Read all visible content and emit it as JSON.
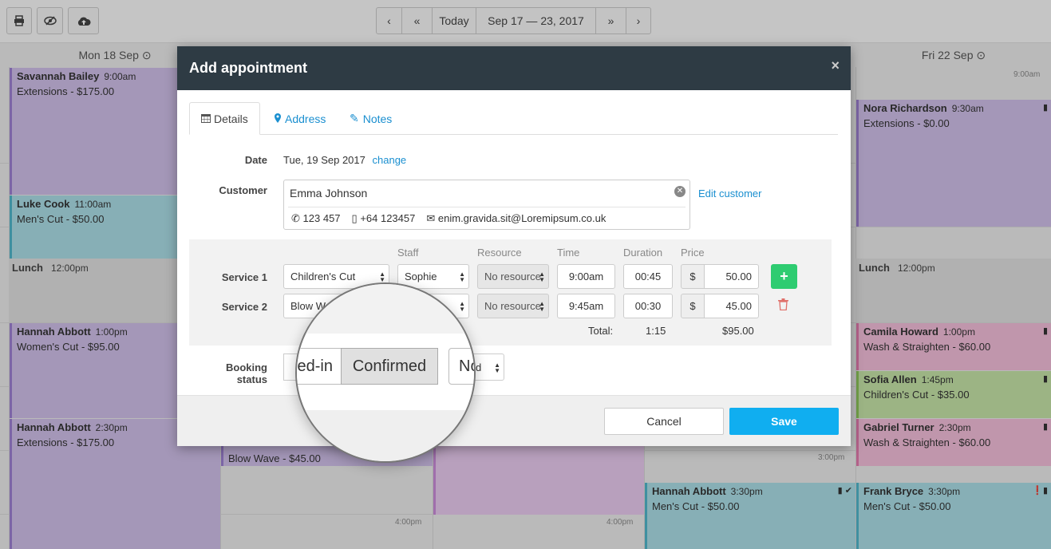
{
  "toolbar": {
    "icons": [
      "printer-icon",
      "hide-icon",
      "cloud-upload-icon"
    ],
    "prev": "‹",
    "prev_week": "«",
    "today": "Today",
    "range": "Sep 17 — 23, 2017",
    "next_week": "»",
    "next": "›"
  },
  "calendar": {
    "mon_label": "Mon 18 Sep",
    "fri_label": "Fri 22 Sep",
    "lunch_label": "Lunch",
    "lunch_time": "12:00pm",
    "time_labels": {
      "t900": "9:00am",
      "t300": "3:00pm",
      "t400": "4:00pm"
    },
    "mon_appts": [
      {
        "name": "Savannah Bailey",
        "time": "9:00am",
        "service": "Extensions - $175.00"
      },
      {
        "name": "Luke Cook",
        "time": "11:00am",
        "service": "Men's Cut - $50.00"
      },
      {
        "name": "Hannah Abbott",
        "time": "1:00pm",
        "service": "Women's Cut - $95.00"
      },
      {
        "name": "Hannah Abbott",
        "time": "2:30pm",
        "service": "Extensions - $175.00"
      }
    ],
    "tue_partial": "Blow Wave - $45.00",
    "thu_appt": {
      "name": "Hannah Abbott",
      "time": "3:30pm",
      "service": "Men's Cut - $50.00"
    },
    "fri_appts": [
      {
        "name": "Nora Richardson",
        "time": "9:30am",
        "service": "Extensions - $0.00"
      },
      {
        "name": "Camila Howard",
        "time": "1:00pm",
        "service": "Wash & Straighten - $60.00"
      },
      {
        "name": "Sofia Allen",
        "time": "1:45pm",
        "service": "Children's Cut - $35.00"
      },
      {
        "name": "Gabriel Turner",
        "time": "2:30pm",
        "service": "Wash & Straighten - $60.00"
      },
      {
        "name": "Frank Bryce",
        "time": "3:30pm",
        "service": "Men's Cut - $50.00"
      }
    ],
    "colors": {
      "purple": "#c9b8e4",
      "teal": "#a9dbe4",
      "pink": "#f1bcd7",
      "green": "#c3e2a6"
    }
  },
  "modal": {
    "title": "Add appointment",
    "close": "×",
    "tabs": {
      "details": "Details",
      "address": "Address",
      "notes": "Notes"
    },
    "date_label": "Date",
    "date_value": "Tue, 19 Sep 2017",
    "date_change": "change",
    "customer_label": "Customer",
    "customer_name": "Emma Johnson",
    "edit_customer": "Edit customer",
    "phone": "123 457",
    "mobile": "+64 123457",
    "email": "enim.gravida.sit@Loremipsum.co.uk",
    "headers": {
      "staff": "Staff",
      "resource": "Resource",
      "time": "Time",
      "duration": "Duration",
      "price": "Price"
    },
    "services": [
      {
        "label": "Service 1",
        "service": "Children's Cut",
        "staff": "Sophie",
        "resource": "No resource",
        "time": "9:00am",
        "duration": "00:45",
        "currency": "$",
        "price": "50.00"
      },
      {
        "label": "Service 2",
        "service": "Blow W",
        "staff": "",
        "resource": "No resource",
        "time": "9:45am",
        "duration": "00:30",
        "currency": "$",
        "price": "45.00"
      }
    ],
    "total_label": "Total:",
    "total_duration": "1:15",
    "total_price": "$95.00",
    "booking_status_label": "Booking status",
    "status_under_left": "",
    "status_under_right": "ed",
    "cancel": "Cancel",
    "save": "Save"
  },
  "magnifier": {
    "left_text": "ed-in",
    "confirmed": "Confirmed",
    "right_text": "No"
  }
}
